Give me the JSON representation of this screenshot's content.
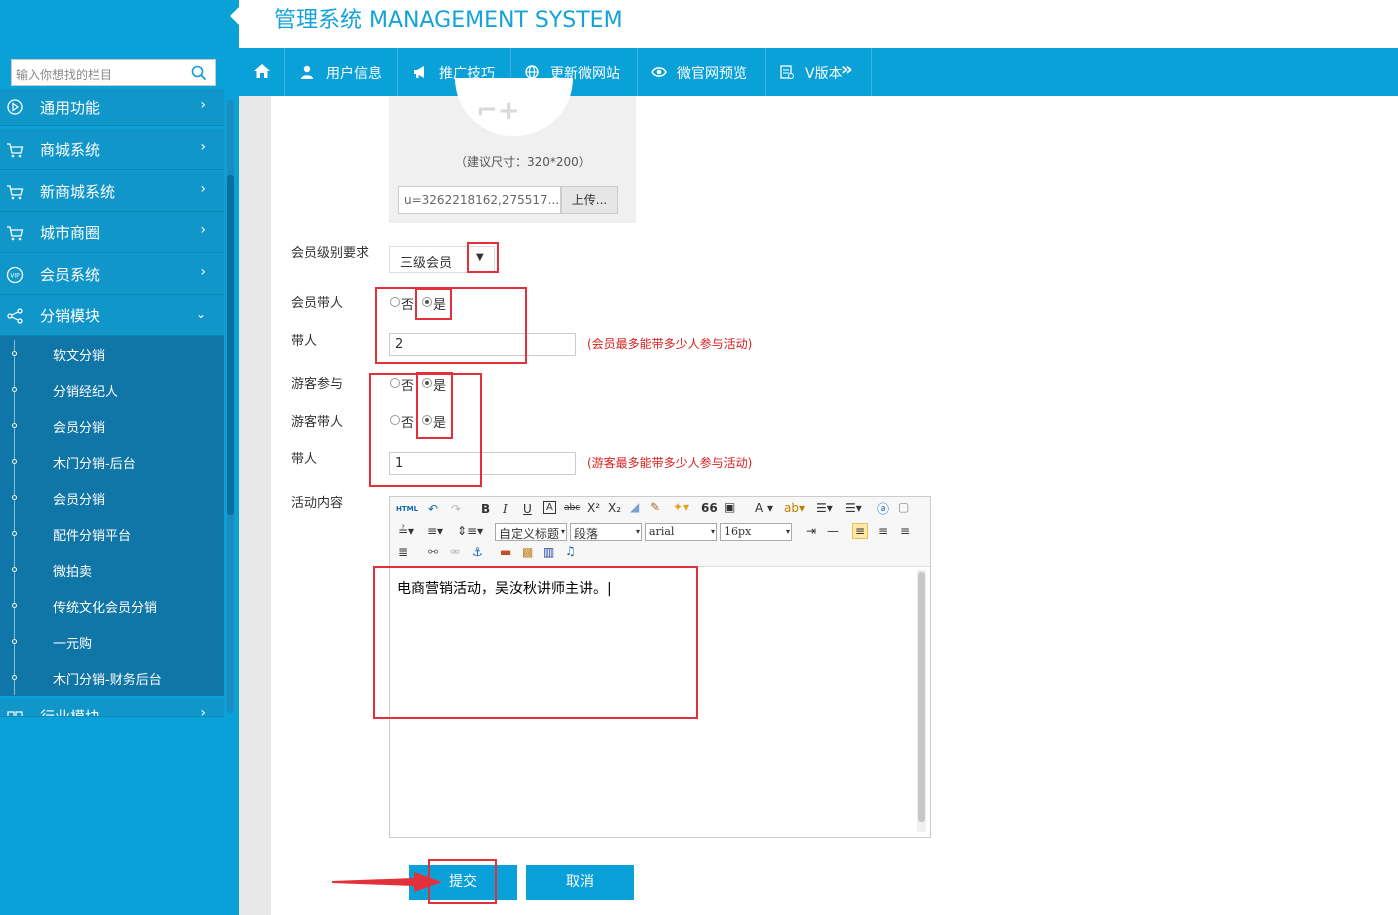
{
  "header": {
    "title": "管理系统 MANAGEMENT SYSTEM"
  },
  "sidebar": {
    "search_placeholder": "输入你想找的栏目",
    "items": [
      {
        "label": "通用功能",
        "icon": "play-circle-icon"
      },
      {
        "label": "商城系统",
        "icon": "cart-icon"
      },
      {
        "label": "新商城系统",
        "icon": "cart-icon"
      },
      {
        "label": "城市商圈",
        "icon": "cart-icon"
      },
      {
        "label": "会员系统",
        "icon": "vip-icon"
      },
      {
        "label": "分销模块",
        "icon": "share-icon"
      },
      {
        "label": "行业模块",
        "icon": "industry-icon"
      }
    ],
    "submenu": [
      "软文分销",
      "分销经纪人",
      "会员分销",
      "木门分销-后台",
      "会员分销",
      "配件分销平台",
      "微拍卖",
      "传统文化会员分销",
      "一元购",
      "木门分销-财务后台"
    ]
  },
  "topnav": {
    "items": [
      {
        "label": "",
        "icon": "home-icon"
      },
      {
        "label": "用户信息",
        "icon": "user-icon"
      },
      {
        "label": "推广技巧",
        "icon": "megaphone-icon"
      },
      {
        "label": "更新微网站",
        "icon": "globe-icon"
      },
      {
        "label": "微官网预览",
        "icon": "eye-icon"
      },
      {
        "label": "V版本",
        "icon": "document-icon"
      }
    ]
  },
  "form": {
    "upload": {
      "hint": "（建议尺寸：320*200）",
      "value": "u=3262218162,275517...",
      "button": "上传..."
    },
    "member_level": {
      "label": "会员级别要求",
      "value": "三级会员"
    },
    "member_bring": {
      "label": "会员带人",
      "option_no": "否",
      "option_yes": "是",
      "selected": "是"
    },
    "member_bring_count": {
      "label": "带人",
      "value": "2",
      "hint": "(会员最多能带多少人参与活动)"
    },
    "guest_join": {
      "label": "游客参与",
      "option_no": "否",
      "option_yes": "是",
      "selected": "是"
    },
    "guest_bring": {
      "label": "游客带人",
      "option_no": "否",
      "option_yes": "是",
      "selected": "是"
    },
    "guest_bring_count": {
      "label": "带人",
      "value": "1",
      "hint": "(游客最多能带多少人参与活动)"
    },
    "content": {
      "label": "活动内容",
      "toolbar": {
        "custom_title": "自定义标题",
        "paragraph": "段落",
        "font": "arial",
        "size": "16px"
      },
      "text": "电商营销活动，吴汝秋讲师主讲。|"
    },
    "submit": "提交",
    "cancel": "取消"
  },
  "colors": {
    "accent": "#0aa1d9",
    "sidebar_item": "#1196c9",
    "submenu": "#1076a8",
    "annotation": "#e2313a"
  }
}
